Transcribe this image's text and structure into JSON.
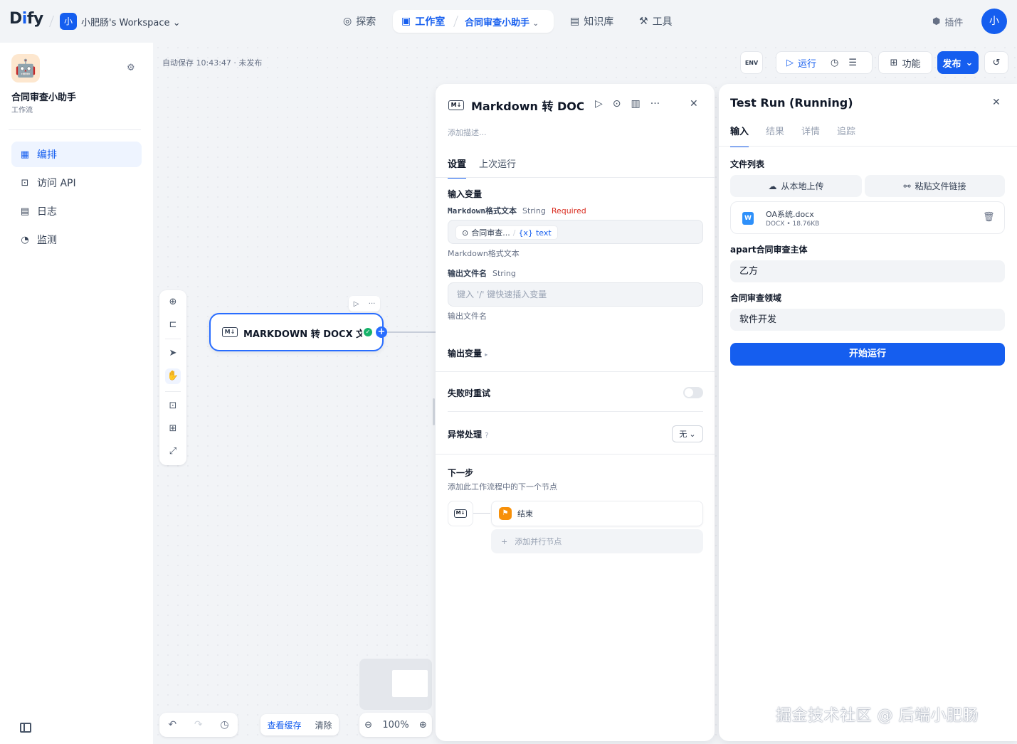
{
  "topbar": {
    "logo_main": "D",
    "logo_i": "i",
    "logo_rest": "fy",
    "workspace_initial": "小",
    "workspace_name": "小肥肠's Workspace",
    "nav": {
      "explore": "探索",
      "studio": "工作室",
      "app_name": "合同审查小助手",
      "knowledge": "知识库",
      "tools": "工具"
    },
    "plugins": "插件",
    "user_initial": "小"
  },
  "sidebar": {
    "app_title": "合同审查小助手",
    "app_type": "工作流",
    "items": [
      {
        "label": "编排",
        "icon": "layout-icon"
      },
      {
        "label": "访问 API",
        "icon": "terminal-icon"
      },
      {
        "label": "日志",
        "icon": "log-icon"
      },
      {
        "label": "监测",
        "icon": "monitor-icon"
      }
    ]
  },
  "canvas": {
    "autosave": "自动保存 10:43:47 · 未发布",
    "toolbar": {
      "env": "ENV",
      "run": "运行",
      "features": "功能",
      "publish": "发布"
    },
    "node": {
      "icon_text": "M↓",
      "title": "MARKDOWN 转 DOCX 文件"
    },
    "bottom": {
      "view_cache": "查看缓存",
      "clear": "清除",
      "zoom": "100%"
    }
  },
  "node_panel": {
    "icon_text": "M↓",
    "title": "Markdown 转 DOCX 文件",
    "desc_placeholder": "添加描述...",
    "tabs": [
      "设置",
      "上次运行"
    ],
    "input_vars_label": "输入变量",
    "var1": {
      "name": "Markdown格式文本",
      "type": "String",
      "required": "Required",
      "chip_node": "合同审查...",
      "chip_var": "text",
      "hint": "Markdown格式文本"
    },
    "var2": {
      "name": "输出文件名",
      "type": "String",
      "placeholder": "键入 '/' 键快速插入变量",
      "hint": "输出文件名"
    },
    "output_vars_label": "输出变量",
    "retry_label": "失败时重试",
    "error_label": "异常处理",
    "error_value": "无",
    "next_step_label": "下一步",
    "next_step_desc": "添加此工作流程中的下一个节点",
    "next_node": "结束",
    "add_parallel": "添加并行节点"
  },
  "run_panel": {
    "title": "Test Run (Running)",
    "tabs": [
      "输入",
      "结果",
      "详情",
      "追踪"
    ],
    "file_list_label": "文件列表",
    "upload_local": "从本地上传",
    "paste_link": "粘贴文件链接",
    "file": {
      "name": "OA系统.docx",
      "meta": "DOCX • 18.76KB"
    },
    "party_label": "apart合同审查主体",
    "party_value": "乙方",
    "domain_label": "合同审查领域",
    "domain_value": "软件开发",
    "run_button": "开始运行"
  },
  "watermark": "掘金技术社区 @ 后端小肥肠"
}
